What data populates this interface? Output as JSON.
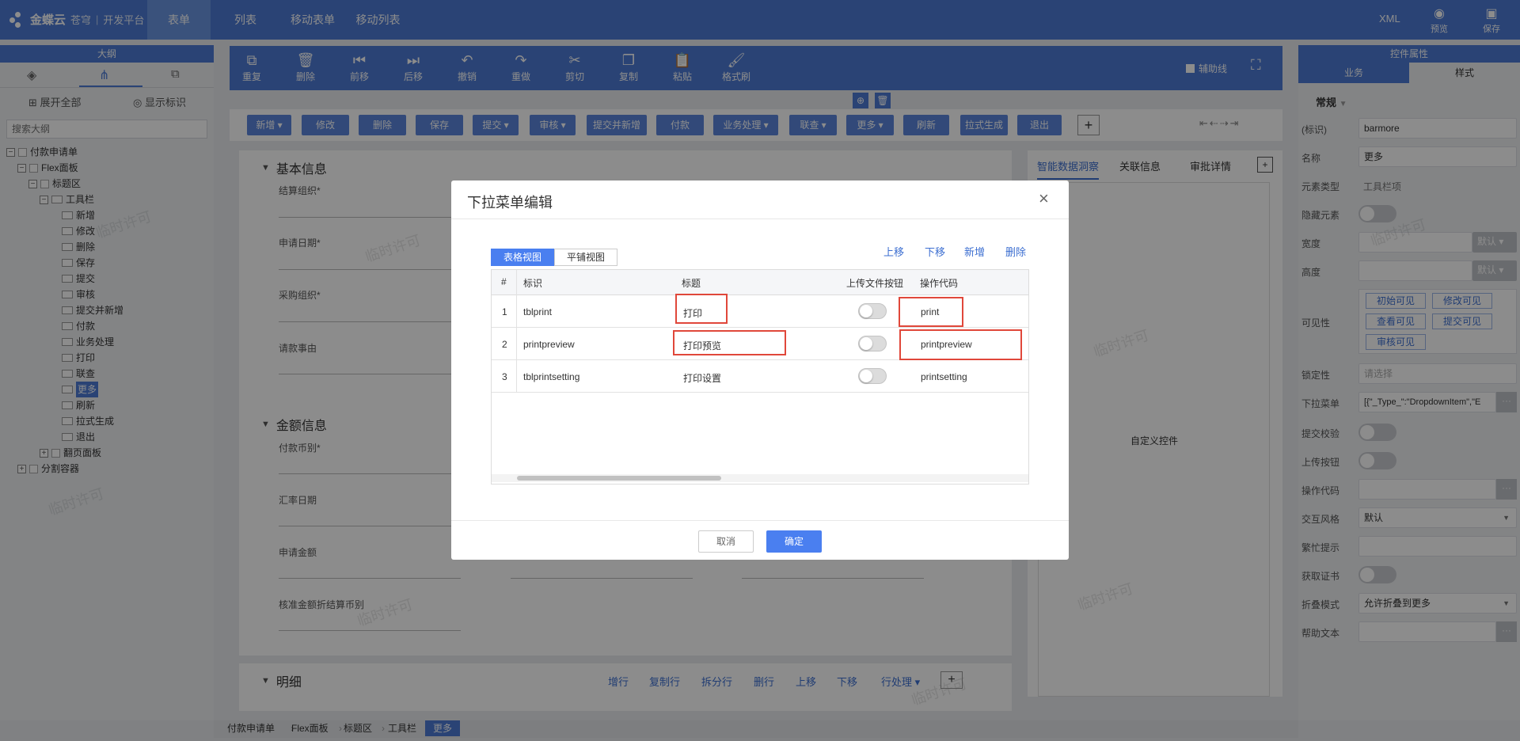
{
  "app": {
    "logo": "金蝶云",
    "logo_sub1": "苍穹",
    "logo_sub2": "开发平台"
  },
  "nav": {
    "tabs": [
      "表单",
      "列表",
      "移动表单",
      "移动列表"
    ],
    "active": "表单"
  },
  "top_actions": {
    "xml": "XML",
    "preview": "预览",
    "save": "保存"
  },
  "outline": {
    "title": "大纲",
    "expand_all": "展开全部",
    "show_id": "显示标识",
    "search_placeholder": "搜索大纲",
    "tree": [
      "付款申请单",
      "Flex面板",
      "标题区",
      "工具栏",
      "新增",
      "修改",
      "删除",
      "保存",
      "提交",
      "审核",
      "提交并新增",
      "付款",
      "业务处理",
      "打印",
      "联查",
      "更多",
      "刷新",
      "拉式生成",
      "退出",
      "翻页面板",
      "分割容器"
    ]
  },
  "toolbar": {
    "items": [
      "重复",
      "删除",
      "前移",
      "后移",
      "撤销",
      "重做",
      "剪切",
      "复制",
      "粘贴",
      "格式刷"
    ],
    "helper_line": "辅助线"
  },
  "form_buttons": [
    "新增",
    "修改",
    "删除",
    "保存",
    "提交",
    "审核",
    "提交并新增",
    "付款",
    "业务处理",
    "联查",
    "更多",
    "刷新",
    "拉式生成",
    "退出"
  ],
  "form": {
    "section_basic": "基本信息",
    "fields_basic": [
      "结算组织*",
      "申请日期*",
      "采购组织*",
      "请款事由"
    ],
    "section_amount": "金额信息",
    "fields_amount": [
      "付款币别*",
      "汇率日期",
      "申请金额",
      "核准金额折结算币别"
    ],
    "section_detail": "明细",
    "detail_actions": [
      "增行",
      "复制行",
      "拆分行",
      "删行",
      "上移",
      "下移",
      "行处理"
    ]
  },
  "side_tabs": {
    "tabs": [
      "智能数据洞察",
      "关联信息",
      "审批详情"
    ],
    "custom_control": "自定义控件"
  },
  "props": {
    "title": "控件属性",
    "tabs": [
      "业务",
      "样式"
    ],
    "group": "常规",
    "rows": {
      "id_label": "(标识)",
      "id_value": "barmore",
      "name_label": "名称",
      "name_value": "更多",
      "type_label": "元素类型",
      "type_value": "工具栏项",
      "hidden_label": "隐藏元素",
      "width_label": "宽度",
      "width_default": "默认",
      "height_label": "高度",
      "height_default": "默认",
      "visible_label": "可见性",
      "visible_buttons": [
        "初始可见",
        "修改可见",
        "查看可见",
        "提交可见",
        "审核可见"
      ],
      "lock_label": "锁定性",
      "lock_placeholder": "请选择",
      "dropdown_label": "下拉菜单",
      "dropdown_value": "[{\"_Type_\":\"DropdownItem\",\"E",
      "submit_check_label": "提交校验",
      "upload_label": "上传按钮",
      "opcode_label": "操作代码",
      "interact_label": "交互风格",
      "interact_value": "默认",
      "busy_label": "繁忙提示",
      "cert_label": "获取证书",
      "fold_label": "折叠模式",
      "fold_value": "允许折叠到更多",
      "help_label": "帮助文本"
    }
  },
  "breadcrumb": [
    "付款申请单",
    "Flex面板",
    "标题区",
    "工具栏",
    "更多"
  ],
  "dialog": {
    "title": "下拉菜单编辑",
    "view_tabs": [
      "表格视图",
      "平铺视图"
    ],
    "actions": [
      "上移",
      "下移",
      "新增",
      "删除"
    ],
    "columns": [
      "#",
      "标识",
      "标题",
      "上传文件按钮",
      "操作代码"
    ],
    "rows": [
      {
        "n": "1",
        "id": "tblprint",
        "title": "打印",
        "code": "print"
      },
      {
        "n": "2",
        "id": "printpreview",
        "title": "打印预览",
        "code": "printpreview"
      },
      {
        "n": "3",
        "id": "tblprintsetting",
        "title": "打印设置",
        "code": "printsetting"
      }
    ],
    "cancel": "取消",
    "ok": "确定"
  },
  "watermark": "临时许可",
  "colors": {
    "brand": "#4d7bd6",
    "highlight_red": "#e0473a",
    "primary_button": "#4a7ff0"
  }
}
